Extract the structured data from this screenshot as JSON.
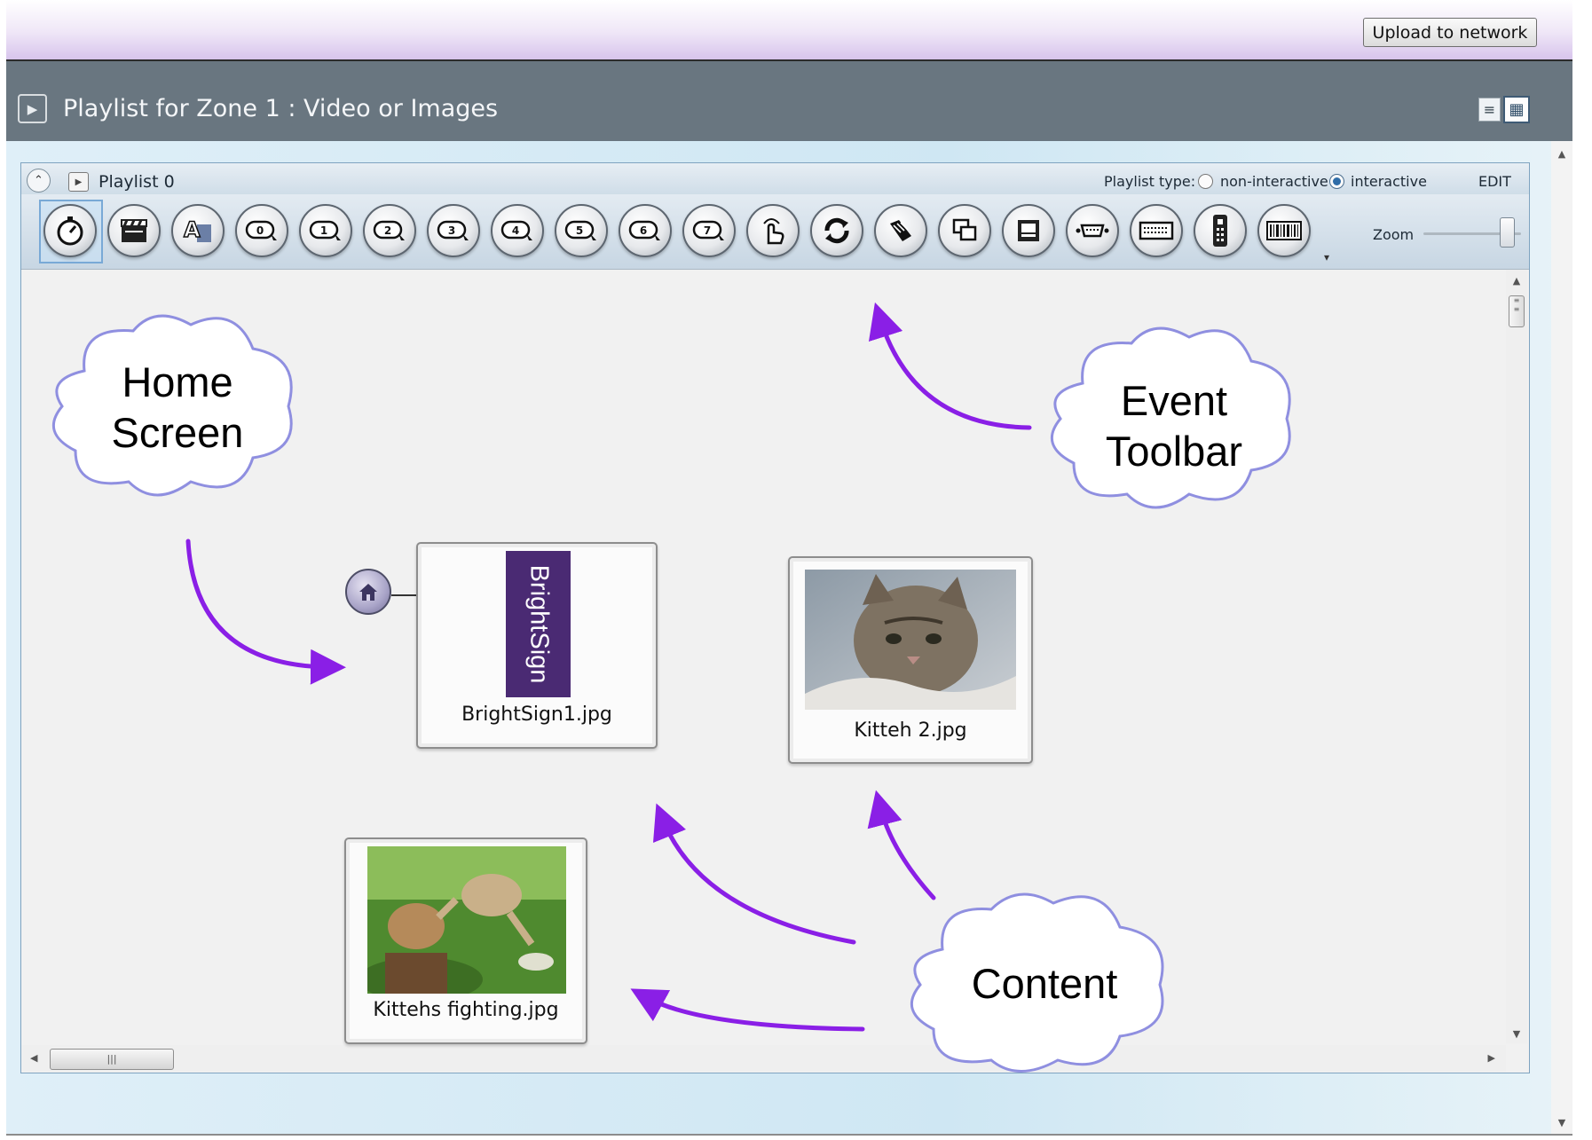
{
  "topbar": {
    "upload_label": "Upload to network"
  },
  "zone": {
    "title": "Playlist for Zone 1 : Video or Images"
  },
  "playlist": {
    "name": "Playlist 0",
    "type_label": "Playlist type:",
    "type_options": [
      "non-interactive",
      "interactive"
    ],
    "type_selected": "interactive",
    "edit_label": "EDIT",
    "zoom_label": "Zoom",
    "zoom_level": 0.9
  },
  "toolbar": {
    "icons": [
      "stopwatch-icon",
      "clapperboard-icon",
      "text-icon",
      "key-0-icon",
      "key-1-icon",
      "key-2-icon",
      "key-3-icon",
      "key-4-icon",
      "key-5-icon",
      "key-6-icon",
      "key-7-icon",
      "touch-icon",
      "refresh-icon",
      "gps-icon",
      "multi-window-icon",
      "monitor-icon",
      "serial-port-icon",
      "keyboard-icon",
      "remote-icon",
      "barcode-icon"
    ],
    "key_numbers": [
      "0",
      "1",
      "2",
      "3",
      "4",
      "5",
      "6",
      "7"
    ]
  },
  "content": {
    "items": [
      {
        "filename": "BrightSign1.jpg",
        "logo_text": "BrightSign"
      },
      {
        "filename": "Kitteh 2.jpg"
      },
      {
        "filename": "Kittehs fighting.jpg"
      }
    ]
  },
  "annotations": {
    "home": [
      "Home",
      "Screen"
    ],
    "toolbar": [
      "Event",
      "Toolbar"
    ],
    "content": "Content"
  },
  "colors": {
    "arrow": "#8a1fe6",
    "cloud_border": "#8f8fe0",
    "zone_bar": "#697680"
  }
}
